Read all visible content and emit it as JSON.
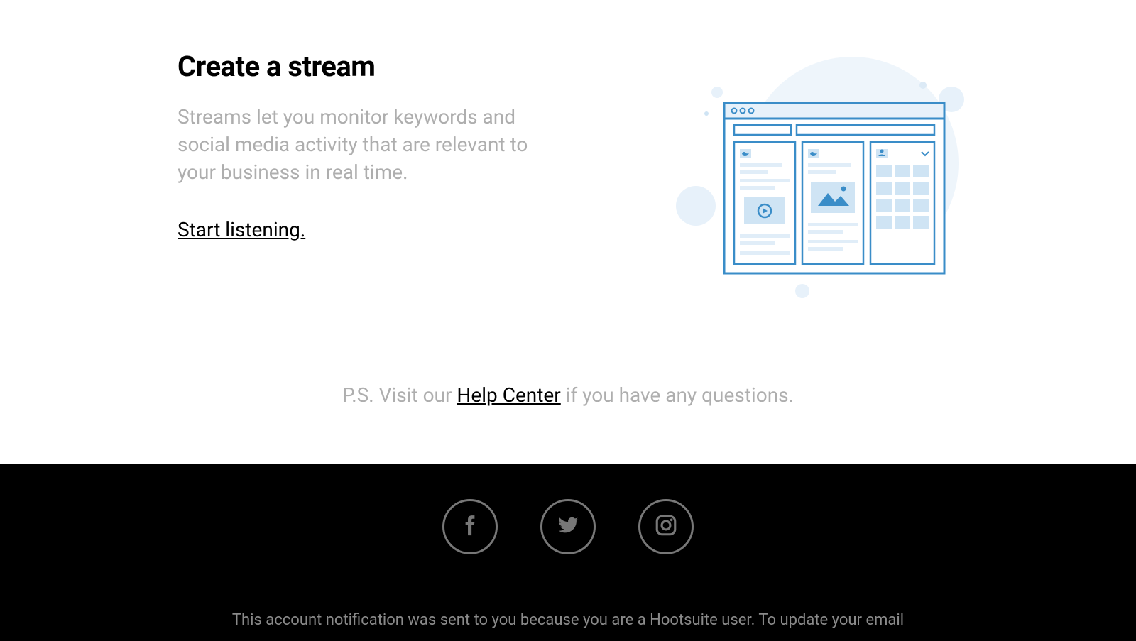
{
  "section": {
    "heading": "Create a stream",
    "description": "Streams let you monitor keywords and social media activity that are relevant to your business in real time.",
    "cta": "Start listening."
  },
  "ps": {
    "prefix": "P.S. Visit our ",
    "link_text": "Help Center",
    "suffix": " if you have any questions."
  },
  "footer": {
    "social": [
      "facebook",
      "twitter",
      "instagram"
    ],
    "notice": "This account notification was sent to you because you are a Hootsuite user. To update your email"
  },
  "colors": {
    "text_muted": "#aeaeae",
    "footer_bg": "#000000",
    "footer_text": "#8a8a8a",
    "illus_outline": "#3a8dc8",
    "illus_fill": "#e7f1fa"
  }
}
